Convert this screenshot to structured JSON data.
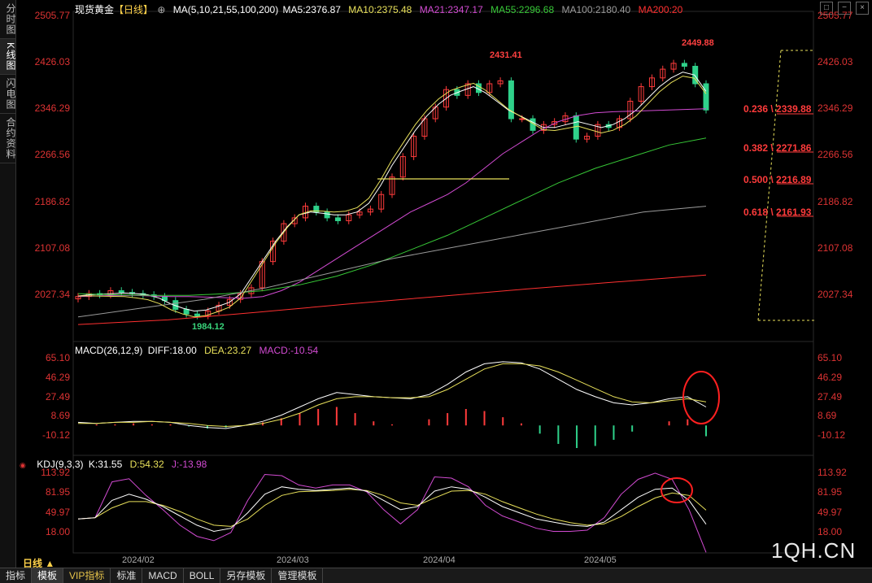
{
  "sidebar": {
    "tabs": [
      {
        "label": "分时图",
        "active": false
      },
      {
        "label": "K线图",
        "active": true
      },
      {
        "label": "闪电图",
        "active": false
      },
      {
        "label": "合约资料",
        "active": false
      }
    ]
  },
  "main": {
    "symbol": "现货黄金",
    "period_tag": "【日线】",
    "ma_header": "MA(5,10,21,55,100,200)",
    "ma": [
      {
        "label": "MA5:2376.87",
        "color": "#ffffff"
      },
      {
        "label": "MA10:2375.48",
        "color": "#e8e05a"
      },
      {
        "label": "MA21:2347.17",
        "color": "#d24bd2"
      },
      {
        "label": "MA55:2296.68",
        "color": "#37c837"
      },
      {
        "label": "MA100:2180.40",
        "color": "#9a9a9a"
      },
      {
        "label": "MA200:20",
        "color": "#ff3030"
      }
    ],
    "price_ticks": [
      "2505.77",
      "2426.03",
      "2346.29",
      "2266.56",
      "2186.82",
      "2107.08",
      "2027.34"
    ],
    "peak1": "2431.41",
    "peak2": "2449.88",
    "low": "1984.12",
    "fib": [
      {
        "ratio": "0.236",
        "price": "2339.88"
      },
      {
        "ratio": "0.382",
        "price": "2271.86"
      },
      {
        "ratio": "0.500",
        "price": "2216.89"
      },
      {
        "ratio": "0.618",
        "price": "2161.93"
      }
    ]
  },
  "macd": {
    "header": "MACD(26,12,9)",
    "diff": "DIFF:18.00",
    "dea": "DEA:23.27",
    "macd": "MACD:-10.54",
    "ticks": [
      "65.10",
      "46.29",
      "27.49",
      "8.69",
      "-10.12"
    ]
  },
  "kdj": {
    "header": "KDJ(9,3,3)",
    "k": "K:31.55",
    "d": "D:54.32",
    "j": "J:-13.98",
    "ticks": [
      "113.92",
      "81.95",
      "49.97",
      "18.00"
    ]
  },
  "dates": [
    "2024/02",
    "2024/03",
    "2024/04",
    "2024/05"
  ],
  "period_selector": "日线 ▲",
  "bottom_tabs": [
    {
      "label": "指标",
      "selected": false
    },
    {
      "label": "模板",
      "selected": true
    },
    {
      "label": "VIP指标",
      "selected": false,
      "vip": true
    },
    {
      "label": "标准",
      "selected": false
    },
    {
      "label": "MACD",
      "selected": false
    },
    {
      "label": "BOLL",
      "selected": false
    },
    {
      "label": "另存模板",
      "selected": false
    },
    {
      "label": "管理模板",
      "selected": false
    }
  ],
  "watermark": "1QH.CN",
  "colors": {
    "up": "#ff3b3b",
    "down": "#2fd18a",
    "ma5": "#ffffff",
    "ma10": "#e8e05a",
    "ma21": "#d24bd2",
    "ma55": "#37c837",
    "ma100": "#9a9a9a",
    "ma200": "#ff3030"
  },
  "chart_data": [
    {
      "type": "line",
      "title": "现货黄金 日线",
      "y_ticks": [
        2505.77,
        2426.03,
        2346.29,
        2266.56,
        2186.82,
        2107.08,
        2027.34
      ],
      "x_ticks": [
        "2024/02",
        "2024/03",
        "2024/04",
        "2024/05"
      ],
      "series": [
        {
          "name": "Close",
          "values": [
            2025,
            2030,
            2028,
            2035,
            2032,
            2030,
            2028,
            2025,
            2018,
            2003,
            1995,
            1992,
            2000,
            2010,
            2020,
            2030,
            2040,
            2085,
            2120,
            2150,
            2160,
            2180,
            2170,
            2160,
            2155,
            2165,
            2170,
            2175,
            2200,
            2230,
            2265,
            2300,
            2330,
            2350,
            2380,
            2370,
            2390,
            2375,
            2390,
            2395,
            2330,
            2330,
            2310,
            2320,
            2325,
            2335,
            2295,
            2300,
            2320,
            2315,
            2330,
            2360,
            2385,
            2400,
            2415,
            2425,
            2420,
            2390,
            2345
          ]
        },
        {
          "name": "MA5",
          "values": [
            2026,
            2028,
            2029,
            2030,
            2031,
            2030,
            2028,
            2022,
            2012,
            2005,
            2000,
            2002,
            2008,
            2015,
            2030,
            2060,
            2090,
            2120,
            2145,
            2165,
            2170,
            2168,
            2165,
            2165,
            2170,
            2185,
            2215,
            2250,
            2280,
            2310,
            2335,
            2355,
            2370,
            2378,
            2385,
            2375,
            2360,
            2345,
            2335,
            2325,
            2315,
            2315,
            2320,
            2325,
            2320,
            2315,
            2320,
            2330,
            2345,
            2365,
            2385,
            2400,
            2410,
            2405,
            2377
          ]
        },
        {
          "name": "MA21",
          "values": [
            2025,
            2026,
            2027,
            2027,
            2026,
            2025,
            2025,
            2024,
            2023,
            2022,
            2025,
            2035,
            2050,
            2070,
            2090,
            2110,
            2130,
            2150,
            2170,
            2185,
            2200,
            2220,
            2245,
            2270,
            2290,
            2310,
            2325,
            2335,
            2340,
            2342,
            2343,
            2344,
            2345,
            2346,
            2347
          ]
        },
        {
          "name": "MA55",
          "values": [
            2030,
            2028,
            2027,
            2027,
            2030,
            2035,
            2045,
            2060,
            2080,
            2105,
            2130,
            2160,
            2190,
            2220,
            2245,
            2265,
            2285,
            2297
          ]
        },
        {
          "name": "MA100",
          "values": [
            1990,
            2005,
            2020,
            2040,
            2065,
            2090,
            2110,
            2130,
            2150,
            2170,
            2180
          ]
        },
        {
          "name": "MA200",
          "values": [
            1977,
            1985,
            1998,
            2012,
            2025,
            2038,
            2050,
            2062
          ]
        }
      ],
      "fibonacci": [
        {
          "ratio": 0.236,
          "price": 2339.88
        },
        {
          "ratio": 0.382,
          "price": 2271.86
        },
        {
          "ratio": 0.5,
          "price": 2216.89
        },
        {
          "ratio": 0.618,
          "price": 2161.93
        }
      ],
      "annotations": [
        {
          "text": "2431.41"
        },
        {
          "text": "2449.88"
        },
        {
          "text": "1984.12"
        }
      ]
    },
    {
      "type": "bar",
      "title": "MACD(26,12,9)",
      "y_ticks": [
        65.1,
        46.29,
        27.49,
        8.69,
        -10.12
      ],
      "series": [
        {
          "name": "DIFF",
          "values": [
            3,
            2,
            3,
            4,
            4,
            3,
            0,
            -2,
            -3,
            0,
            4,
            10,
            18,
            26,
            32,
            30,
            28,
            27,
            26,
            30,
            40,
            52,
            60,
            62,
            61,
            55,
            45,
            35,
            28,
            22,
            20,
            22,
            26,
            28,
            18
          ]
        },
        {
          "name": "DEA",
          "values": [
            2,
            2,
            3,
            3,
            4,
            3,
            2,
            0,
            -1,
            0,
            2,
            6,
            12,
            20,
            26,
            28,
            28,
            27,
            27,
            28,
            35,
            45,
            55,
            60,
            60,
            58,
            52,
            44,
            36,
            28,
            23,
            22,
            24,
            26,
            23
          ]
        },
        {
          "name": "MACD",
          "values": [
            0,
            1,
            1,
            2,
            1,
            1,
            -1,
            -3,
            -2,
            0,
            3,
            7,
            12,
            16,
            18,
            12,
            4,
            1,
            0,
            6,
            12,
            16,
            14,
            8,
            2,
            -8,
            -18,
            -22,
            -20,
            -14,
            -6,
            0,
            4,
            6,
            -10.54
          ]
        }
      ]
    },
    {
      "type": "line",
      "title": "KDJ(9,3,3)",
      "y_ticks": [
        113.92,
        81.95,
        49.97,
        18.0
      ],
      "series": [
        {
          "name": "K",
          "values": [
            40,
            42,
            70,
            80,
            72,
            60,
            45,
            30,
            20,
            25,
            50,
            80,
            92,
            88,
            86,
            88,
            90,
            85,
            70,
            55,
            60,
            85,
            92,
            88,
            75,
            60,
            50,
            40,
            35,
            30,
            28,
            35,
            55,
            75,
            88,
            90,
            70,
            31.55
          ]
        },
        {
          "name": "D",
          "values": [
            40,
            42,
            58,
            68,
            68,
            62,
            52,
            40,
            30,
            28,
            40,
            62,
            78,
            84,
            85,
            86,
            88,
            86,
            78,
            66,
            62,
            74,
            85,
            86,
            80,
            68,
            58,
            48,
            40,
            34,
            30,
            32,
            44,
            60,
            74,
            82,
            78,
            54.32
          ]
        },
        {
          "name": "J",
          "values": [
            40,
            42,
            100,
            105,
            78,
            55,
            30,
            12,
            5,
            18,
            70,
            112,
            110,
            95,
            90,
            95,
            95,
            84,
            55,
            32,
            55,
            108,
            106,
            92,
            62,
            45,
            35,
            25,
            20,
            20,
            22,
            42,
            80,
            104,
            114,
            104,
            55,
            -13.98
          ]
        }
      ]
    }
  ]
}
